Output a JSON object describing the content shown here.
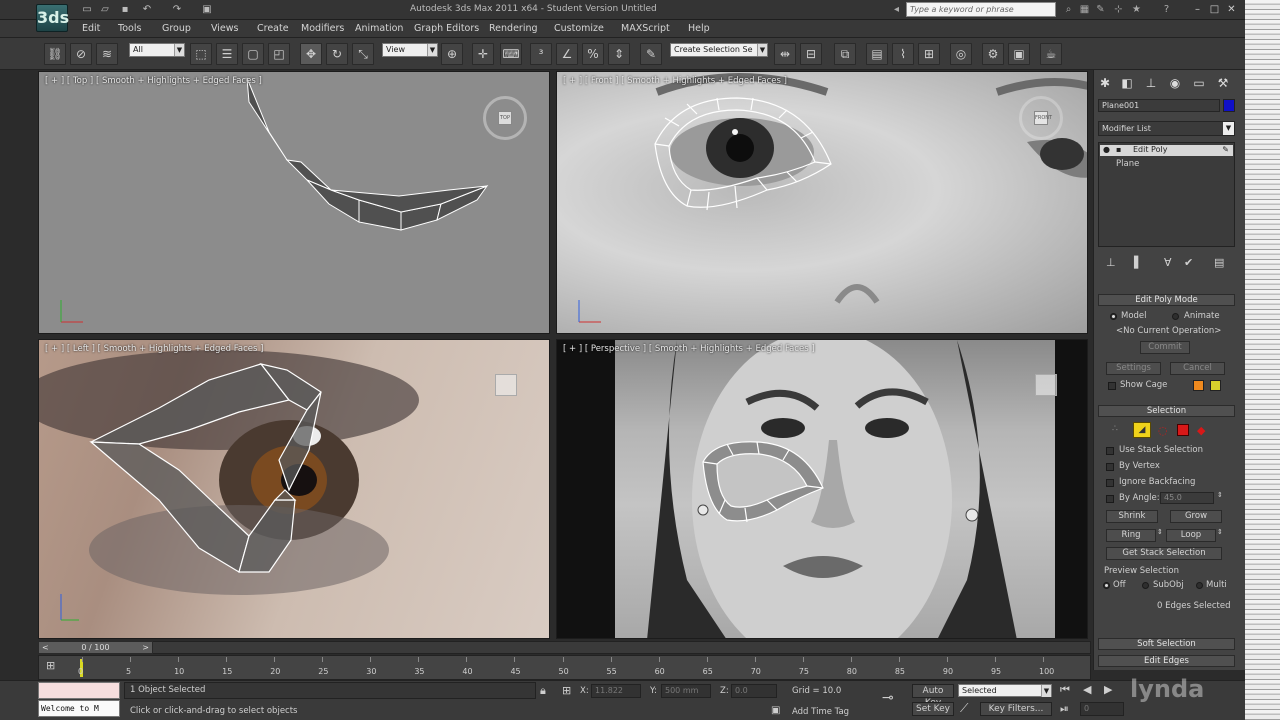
{
  "app": {
    "title": "Autodesk 3ds Max  2011 x64  -  Student Version    Untitled",
    "logo": "3ds",
    "search_placeholder": "Type a keyword or phrase"
  },
  "menu": [
    "Edit",
    "Tools",
    "Group",
    "Views",
    "Create",
    "Modifiers",
    "Animation",
    "Graph Editors",
    "Rendering",
    "Customize",
    "MAXScript",
    "Help"
  ],
  "toolbar": {
    "selection_filter": "All",
    "reference_coord": "View",
    "named_selection": "Create Selection Se"
  },
  "viewports": {
    "top": {
      "label": "[ + ] [ Top ] [ Smooth + Highlights + Edged Faces ]"
    },
    "front": {
      "label": "[ + ] [ Front ] [ Smooth + Highlights + Edged Faces ]"
    },
    "left": {
      "label": "[ + ] [ Left ] [ Smooth + Highlights + Edged Faces ]"
    },
    "perspective": {
      "label": "[ + ] [ Perspective ] [ Smooth + Highlights + Edged Faces ]"
    }
  },
  "command_panel": {
    "object_name": "Plane001",
    "object_color": "#1010c8",
    "modifier_list": "Modifier List",
    "stack": [
      "Edit Poly",
      "Plane"
    ],
    "edit_poly_mode": {
      "title": "Edit Poly Mode",
      "model": "Model",
      "animate": "Animate",
      "current_op": "<No Current Operation>",
      "commit": "Commit",
      "settings": "Settings",
      "cancel": "Cancel",
      "show_cage": "Show Cage"
    },
    "selection": {
      "title": "Selection",
      "use_stack": "Use Stack Selection",
      "by_vertex": "By Vertex",
      "ignore_backfacing": "Ignore Backfacing",
      "by_angle": "By Angle:",
      "angle_value": "45.0",
      "shrink": "Shrink",
      "grow": "Grow",
      "ring": "Ring",
      "loop": "Loop",
      "get_stack": "Get Stack Selection",
      "preview": "Preview Selection",
      "off": "Off",
      "subobj": "SubObj",
      "multi": "Multi",
      "status": "0 Edges Selected"
    },
    "soft_selection": "Soft Selection",
    "edit_edges": "Edit Edges"
  },
  "timeline": {
    "frame_readout": "0 / 100",
    "frame_current": 0,
    "frame_total": 100,
    "ticks": [
      "0",
      "5",
      "10",
      "15",
      "20",
      "25",
      "30",
      "35",
      "40",
      "45",
      "50",
      "55",
      "60",
      "65",
      "70",
      "75",
      "80",
      "85",
      "90",
      "95",
      "100"
    ]
  },
  "status": {
    "listener": "Welcome to M",
    "objects_selected": "1 Object Selected",
    "prompt": "Click or click-and-drag to select objects",
    "x_label": "X:",
    "y_label": "Y:",
    "z_label": "Z:",
    "x_value": "11.822",
    "y_value": "500 mm",
    "z_value": "0.0",
    "grid": "Grid = 10.0",
    "add_time_tag": "Add Time Tag",
    "auto_key": "Auto Key",
    "set_key": "Set Key",
    "key_mode": "Selected",
    "key_filters": "Key Filters...",
    "frame": "0"
  }
}
